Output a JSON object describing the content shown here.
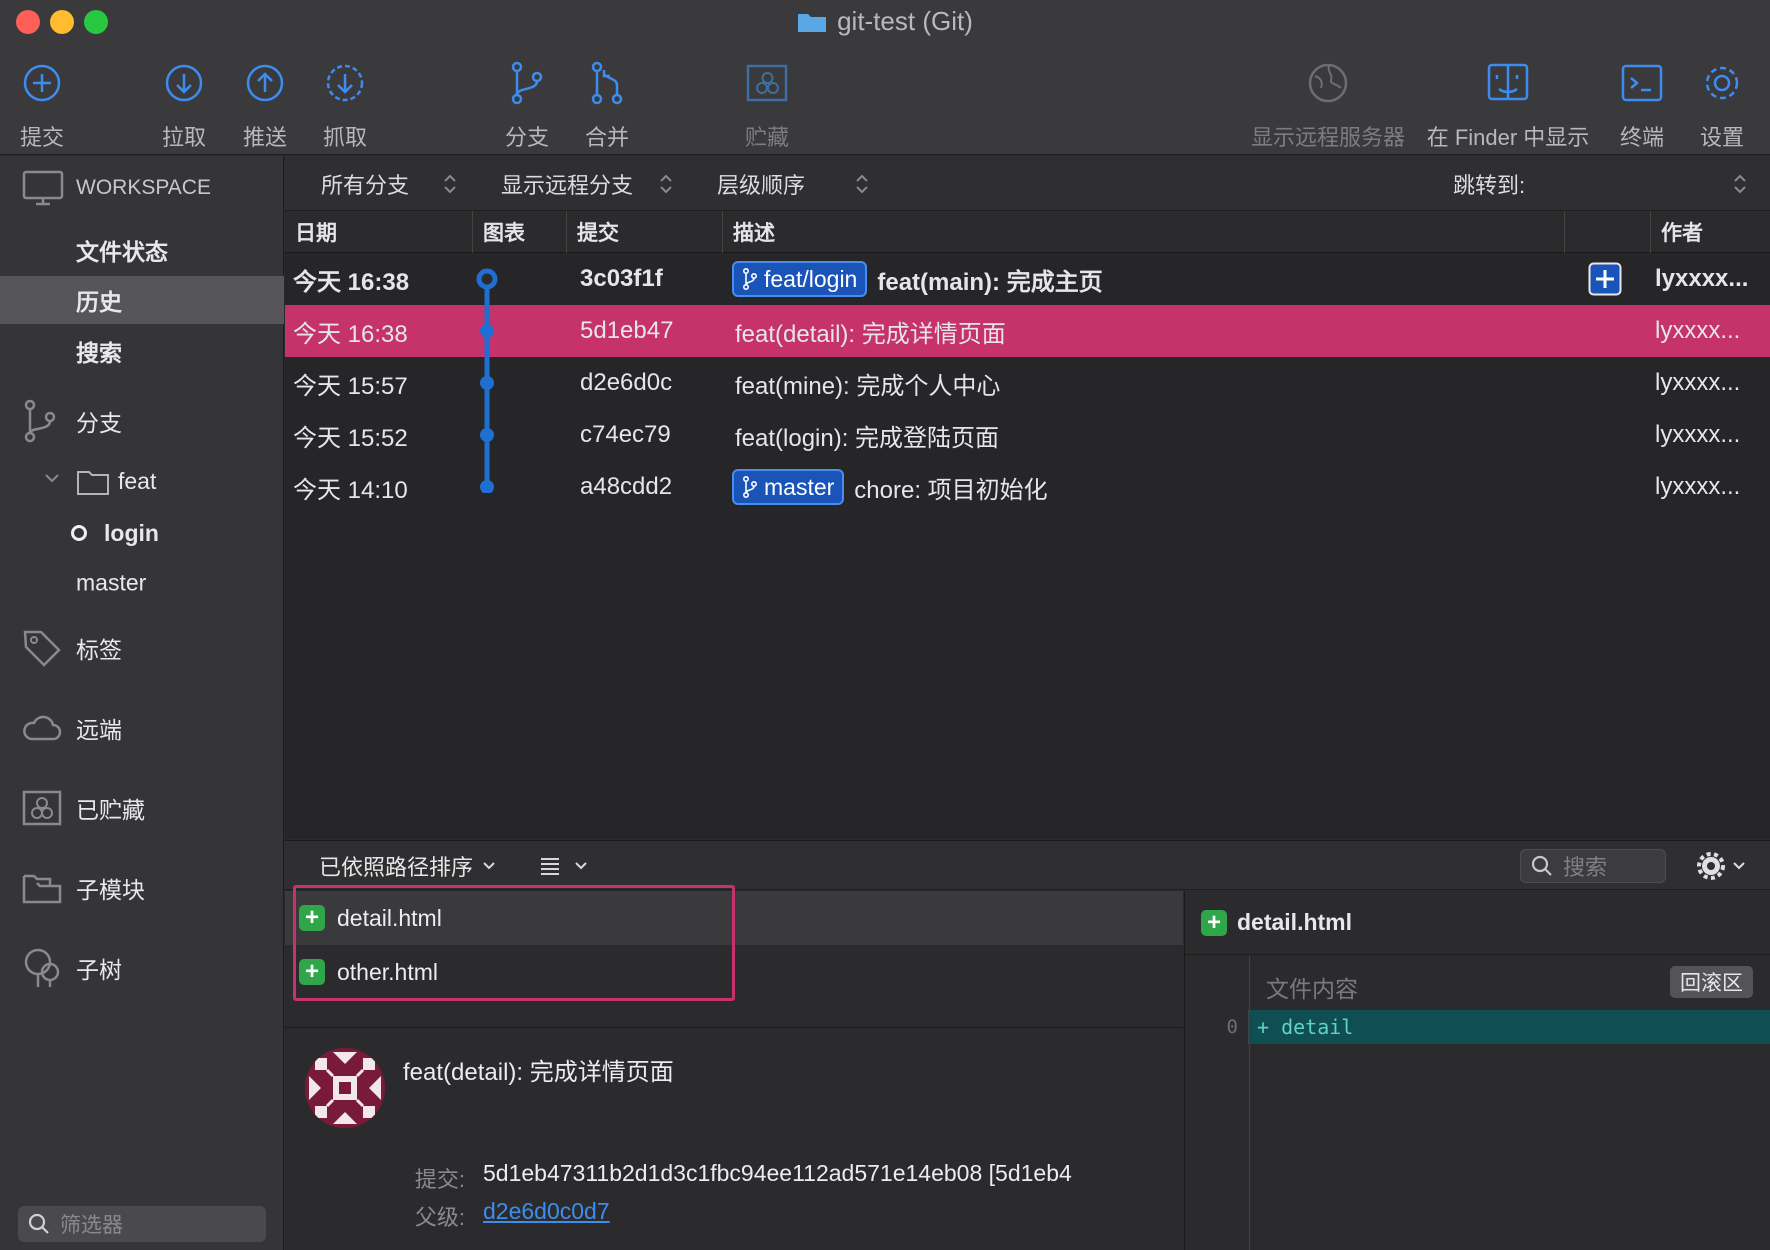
{
  "window": {
    "title": "git-test (Git)"
  },
  "toolbar": {
    "commit": "提交",
    "pull": "拉取",
    "push": "推送",
    "fetch": "抓取",
    "branch": "分支",
    "merge": "合并",
    "stash": "贮藏",
    "show_remote": "显示远程服务器",
    "show_in_finder": "在 Finder 中显示",
    "terminal": "终端",
    "settings": "设置"
  },
  "sidebar": {
    "workspace": "WORKSPACE",
    "file_status": "文件状态",
    "history": "历史",
    "search": "搜索",
    "branches": "分支",
    "feat_folder": "feat",
    "login_branch": "login",
    "master_branch": "master",
    "tags": "标签",
    "remotes": "远端",
    "stashes": "已贮藏",
    "submodules": "子模块",
    "subtrees": "子树",
    "filter_placeholder": "筛选器"
  },
  "filterbar": {
    "all_branches": "所有分支",
    "show_remote_branches": "显示远程分支",
    "order": "层级顺序",
    "jump_to": "跳转到:"
  },
  "columns": {
    "date": "日期",
    "graph": "图表",
    "commit": "提交",
    "description": "描述",
    "author": "作者"
  },
  "commits": [
    {
      "date": "今天 16:38",
      "hash": "3c03f1f",
      "tag": "feat/login",
      "message": "feat(main): 完成主页",
      "author": "lyxxxx..."
    },
    {
      "date": "今天 16:38",
      "hash": "5d1eb47",
      "tag": "",
      "message": "feat(detail): 完成详情页面",
      "author": "lyxxxx..."
    },
    {
      "date": "今天 15:57",
      "hash": "d2e6d0c",
      "tag": "",
      "message": "feat(mine): 完成个人中心",
      "author": "lyxxxx..."
    },
    {
      "date": "今天 15:52",
      "hash": "c74ec79",
      "tag": "",
      "message": "feat(login): 完成登陆页面",
      "author": "lyxxxx..."
    },
    {
      "date": "今天 14:10",
      "hash": "a48cdd2",
      "tag": "master",
      "message": "chore: 项目初始化",
      "author": "lyxxxx..."
    }
  ],
  "files_pane": {
    "sort_label": "已依照路径排序",
    "search_placeholder": "搜索",
    "files": [
      "detail.html",
      "other.html"
    ]
  },
  "commit_detail": {
    "message": "feat(detail): 完成详情页面",
    "commit_label": "提交:",
    "commit_value": "5d1eb47311b2d1d3c1fbc94ee112ad571e14eb08 [5d1eb4",
    "parent_label": "父级:",
    "parent_value": "d2e6d0c0d7"
  },
  "diff": {
    "filename": "detail.html",
    "header": "文件内容",
    "revert": "回滚区",
    "line_no": "0",
    "line": "+ detail"
  },
  "colors": {
    "selection": "#c6326c",
    "accent_blue": "#1a54b8",
    "graph_blue": "#1f6fd0",
    "added_green": "#2fa64a"
  }
}
